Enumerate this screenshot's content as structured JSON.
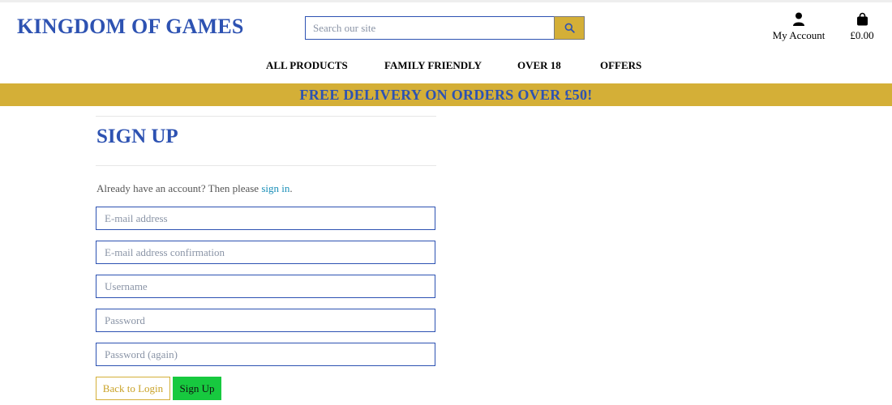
{
  "brand": {
    "name": "KINGDOM OF GAMES"
  },
  "search": {
    "placeholder": "Search our site",
    "icon": "search-icon"
  },
  "account": {
    "label": "My Account",
    "icon": "user-icon"
  },
  "cart": {
    "total": "£0.00",
    "icon": "shopping-bag-icon"
  },
  "nav": {
    "items": [
      "ALL PRODUCTS",
      "FAMILY FRIENDLY",
      "OVER 18",
      "OFFERS"
    ]
  },
  "banner": {
    "text": "FREE DELIVERY ON ORDERS OVER £50!"
  },
  "signup": {
    "title": "SIGN UP",
    "intro": "Already have an account? Then please",
    "signin_link": "sign in",
    "intro_end": ".",
    "fields": {
      "email": "E-mail address",
      "email_confirm": "E-mail address confirmation",
      "username": "Username",
      "password": "Password",
      "password_again": "Password (again)"
    },
    "back_label": "Back to Login",
    "submit_label": "Sign Up"
  },
  "colors": {
    "brand_blue": "#2d52b2",
    "gold": "#d4af37",
    "signup_green": "#17c93f",
    "link_blue": "#1a8fb8"
  }
}
